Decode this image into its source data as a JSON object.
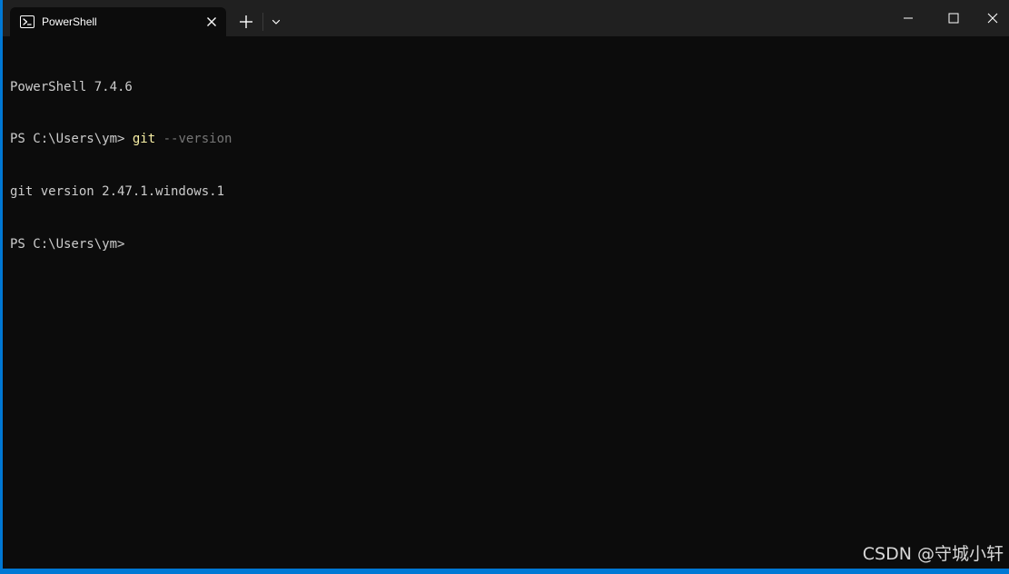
{
  "tab": {
    "title": "PowerShell",
    "icon": "powershell-icon"
  },
  "titlebar": {
    "new_tab_icon": "plus-icon",
    "dropdown_icon": "chevron-down-icon"
  },
  "window_controls": {
    "minimize_icon": "minimize-icon",
    "maximize_icon": "maximize-icon",
    "close_icon": "close-icon"
  },
  "terminal": {
    "banner": "PowerShell 7.4.6",
    "lines": [
      {
        "prompt": "PS C:\\Users\\ym> ",
        "command": "git",
        "args": " --version"
      },
      {
        "output": "git version 2.47.1.windows.1"
      },
      {
        "prompt": "PS C:\\Users\\ym>",
        "command": "",
        "args": ""
      }
    ]
  },
  "watermark": "CSDN @守城小轩",
  "colors": {
    "background": "#0c0c0c",
    "titlebar": "#202020",
    "foreground": "#cccccc",
    "command": "#f9f1a5",
    "argument": "#767676",
    "accent_border": "#0078d4"
  }
}
